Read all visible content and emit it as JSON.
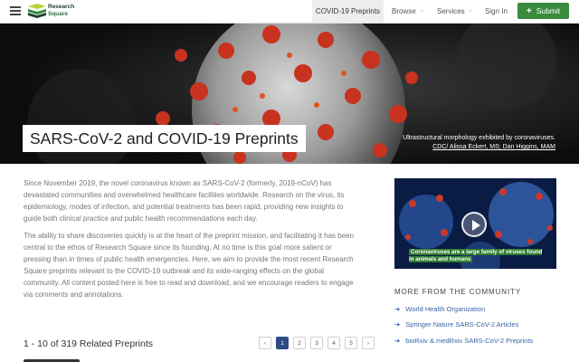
{
  "header": {
    "logo_line1": "Research",
    "logo_line2": "Square",
    "nav": {
      "covid": "COVID-19 Preprints",
      "browse": "Browse",
      "services": "Services",
      "sign_in": "Sign In",
      "submit": "Submit"
    }
  },
  "hero": {
    "title": "SARS-CoV-2 and COVID-19 Preprints",
    "caption": "Ultrastructural morphology exhibited by coronaviruses.",
    "credit": "CDC/ Alissa Eckert, MS; Dan Higgins, MAM"
  },
  "intro": {
    "p1": "Since November 2019, the novel coronavirus known as SARS-CoV-2 (formerly, 2019-nCoV) has devastated communities and overwhelmed healthcare facilities worldwide. Research on the virus, its epidemiology, modes of infection, and potential treatments has been rapid, providing new insights to guide both clinical practice and public health recommendations each day.",
    "p2": "The ability to share discoveries quickly is at the heart of the preprint mission, and facilitating it has been central to the ethos of Research Square since its founding. At no time is this goal more salient or pressing than in times of public health emergencies. Here, we aim to provide the most recent Research Square preprints relevant to the COVID-19 outbreak and its wide-ranging effects on the global community. All content posted here is free to read and download, and we encourage readers to engage via comments and annotations."
  },
  "video": {
    "caption": "Coronaviruses are a large family of viruses found in animals and humans"
  },
  "community": {
    "heading": "MORE FROM THE COMMUNITY",
    "links": [
      "World Health Organization",
      "Springer Nature SARS-CoV-2 Articles",
      "bioRxiv & medRxiv SARS-CoV-2 Preprints"
    ]
  },
  "results": {
    "summary": "1 - 10 of 319 Related Preprints"
  },
  "pagination": {
    "prev": "‹",
    "pages": [
      "1",
      "2",
      "3",
      "4",
      "5"
    ],
    "current": "1",
    "next": "›"
  },
  "colors": {
    "submit_green": "#3a8b3e",
    "link_blue": "#3a63a8",
    "current_page": "#2e4b87"
  }
}
